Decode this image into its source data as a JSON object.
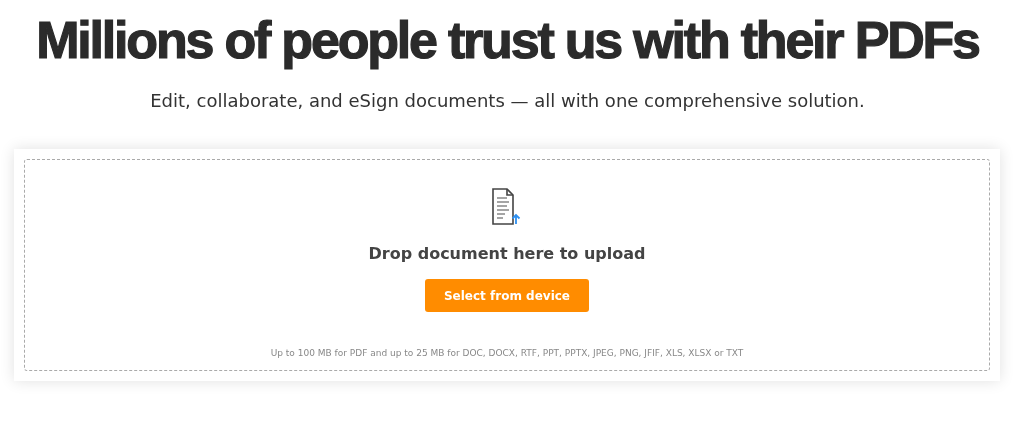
{
  "headline": "Millions of people trust us with their PDFs",
  "subheadline": "Edit, collaborate, and eSign documents — all with one comprehensive solution.",
  "upload": {
    "prompt": "Drop document here to upload",
    "button": "Select from device",
    "note": "Up to 100 MB for PDF and up to 25 MB for DOC, DOCX, RTF, PPT, PPTX, JPEG, PNG, JFIF, XLS, XLSX or TXT"
  }
}
